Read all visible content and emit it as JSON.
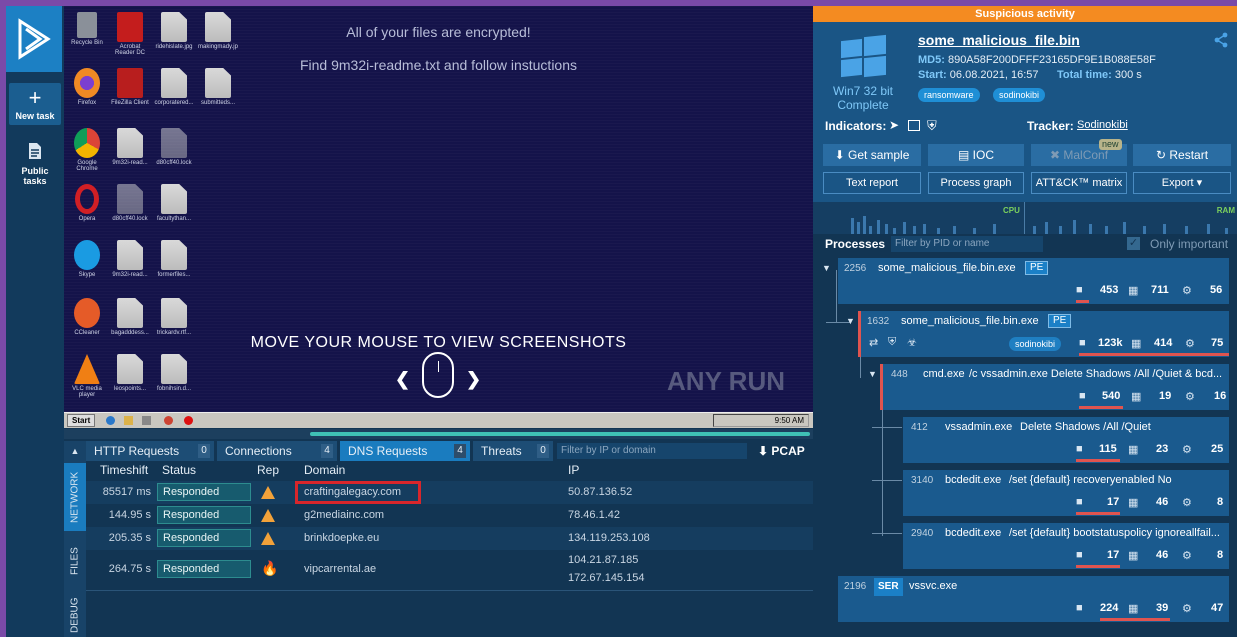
{
  "nav": {
    "new_task": "New task",
    "public_tasks": "Public tasks"
  },
  "screenshot": {
    "line1": "All of your files are encrypted!",
    "line2": "Find 9m32i-readme.txt and follow instuctions",
    "overlay": "MOVE YOUR MOUSE TO VIEW SCREENSHOTS",
    "brand": "ANY RUN",
    "start": "Start",
    "clock": "9:50 AM",
    "icons": [
      "Recycle Bin",
      "Acrobat Reader DC",
      "ridehislate.jpg",
      "makingmady.jp",
      "Firefox",
      "FileZilla Client",
      "corporatered...",
      "submitteds...",
      "Google Chrome",
      "9m32i-read...",
      "d80cff40.lock",
      "Opera",
      "d80cff40.lock",
      "facultythan...",
      "Skype",
      "9m32i-read...",
      "formerfiles...",
      "CCleaner",
      "bagadddess...",
      "trickardv.rtf...",
      "VLC media player",
      "leospoints...",
      "fobnihsin.d..."
    ]
  },
  "network": {
    "side_tabs": [
      "NETWORK",
      "FILES",
      "DEBUG"
    ],
    "tabs": [
      {
        "label": "HTTP Requests",
        "count": "0"
      },
      {
        "label": "Connections",
        "count": "4"
      },
      {
        "label": "DNS Requests",
        "count": "4"
      },
      {
        "label": "Threats",
        "count": "0"
      }
    ],
    "filter_placeholder": "Filter by IP or domain",
    "pcap": "PCAP",
    "columns": [
      "Timeshift",
      "Status",
      "Rep",
      "Domain",
      "IP"
    ],
    "rows": [
      {
        "time": "85517 ms",
        "status": "Responded",
        "rep": "warning",
        "domain": "craftingalegacy.com",
        "ip": "50.87.136.52",
        "ip2": ""
      },
      {
        "time": "144.95 s",
        "status": "Responded",
        "rep": "warning",
        "domain": "g2mediainc.com",
        "ip": "78.46.1.42",
        "ip2": ""
      },
      {
        "time": "205.35 s",
        "status": "Responded",
        "rep": "warning",
        "domain": "brinkdoepke.eu",
        "ip": "134.119.253.108",
        "ip2": ""
      },
      {
        "time": "264.75 s",
        "status": "Responded",
        "rep": "danger",
        "domain": "vipcarrental.ae",
        "ip": "104.21.87.185",
        "ip2": "172.67.145.154"
      }
    ]
  },
  "task": {
    "banner": "Suspicious activity",
    "os": "Win7 32 bit",
    "state": "Complete",
    "filename": "some_malicious_file.bin",
    "md5_label": "MD5:",
    "md5": "890A58F200DFFF23165DF9E1B088E58F",
    "start_label": "Start:",
    "start": "06.08.2021, 16:57",
    "total_label": "Total time:",
    "total": "300 s",
    "tags": [
      "ransomware",
      "sodinokibi"
    ],
    "indicators_label": "Indicators:",
    "tracker_label": "Tracker:",
    "tracker": "Sodinokibi",
    "buttons": {
      "get_sample": "Get sample",
      "ioc": "IOC",
      "malconf": "MalConf",
      "new_badge": "new",
      "restart": "Restart"
    },
    "buttons2": {
      "text_report": "Text report",
      "process_graph": "Process graph",
      "attck": "ATT&CK™ matrix",
      "export": "Export"
    },
    "cpu": "CPU",
    "ram": "RAM",
    "accent": "#1a7cbf",
    "warning_color": "#f48b21"
  },
  "processes": {
    "label": "Processes",
    "filter_placeholder": "Filter by PID or name",
    "only_important": "Only important",
    "list": [
      {
        "pid": "2256",
        "name": "some_malicious_file.bin.exe",
        "args": "",
        "badge": "PE",
        "files": "453",
        "reg": "711",
        "mods": "56",
        "tag": ""
      },
      {
        "pid": "1632",
        "name": "some_malicious_file.bin.exe",
        "args": "",
        "badge": "PE",
        "files": "123k",
        "reg": "414",
        "mods": "75",
        "tag": "sodinokibi"
      },
      {
        "pid": "448",
        "name": "cmd.exe",
        "args": "/c vssadmin.exe Delete Shadows /All /Quiet & bcd...",
        "badge": "",
        "files": "540",
        "reg": "19",
        "mods": "16",
        "tag": ""
      },
      {
        "pid": "412",
        "name": "vssadmin.exe",
        "args": "Delete Shadows /All /Quiet",
        "badge": "",
        "files": "115",
        "reg": "23",
        "mods": "25",
        "tag": ""
      },
      {
        "pid": "3140",
        "name": "bcdedit.exe",
        "args": "/set {default} recoveryenabled No",
        "badge": "",
        "files": "17",
        "reg": "46",
        "mods": "8",
        "tag": ""
      },
      {
        "pid": "2940",
        "name": "bcdedit.exe",
        "args": "/set {default} bootstatuspolicy ignoreallfail...",
        "badge": "",
        "files": "17",
        "reg": "46",
        "mods": "8",
        "tag": ""
      },
      {
        "pid": "2196",
        "name": "vssvc.exe",
        "args": "",
        "badge": "SER",
        "files": "224",
        "reg": "39",
        "mods": "47",
        "tag": ""
      }
    ]
  }
}
